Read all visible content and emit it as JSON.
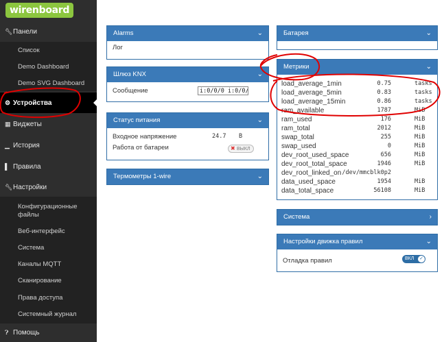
{
  "logo": "wirenboard",
  "sidebar": {
    "panels": "Панели",
    "panel_items": [
      "Список",
      "Demo Dashboard",
      "Demo SVG Dashboard"
    ],
    "devices": "Устройства",
    "widgets": "Виджеты",
    "history": "История",
    "rules": "Правила",
    "settings": "Настройки",
    "settings_items": [
      "Конфигурационные файлы",
      "Веб-интерфейс",
      "Система",
      "Каналы MQTT",
      "Сканирование",
      "Права доступа",
      "Системный журнал"
    ],
    "help": "Помощь"
  },
  "panels": {
    "alarms": {
      "title": "Alarms",
      "log": "Лог"
    },
    "knx": {
      "title": "Шлюз KNX",
      "message_label": "Сообщение",
      "message_value": "i:0/0/0 i:0/0/0"
    },
    "power": {
      "title": "Статус питания",
      "voltage_label": "Входное напряжение",
      "voltage_value": "24.7",
      "voltage_unit": "В",
      "battery_label": "Работа от батареи",
      "battery_toggle": "ВЫКЛ"
    },
    "onewire": {
      "title": "Термометры 1-wire"
    },
    "battery": {
      "title": "Батарея"
    },
    "metrics": {
      "title": "Метрики",
      "rows": [
        {
          "name": "load_average_1min",
          "value": "0.75",
          "unit": "tasks"
        },
        {
          "name": "load_average_5min",
          "value": "0.83",
          "unit": "tasks"
        },
        {
          "name": "load_average_15min",
          "value": "0.86",
          "unit": "tasks"
        },
        {
          "name": "ram_available",
          "value": "1787",
          "unit": "MiB"
        },
        {
          "name": "ram_used",
          "value": "176",
          "unit": "MiB"
        },
        {
          "name": "ram_total",
          "value": "2012",
          "unit": "MiB"
        },
        {
          "name": "swap_total",
          "value": "255",
          "unit": "MiB"
        },
        {
          "name": "swap_used",
          "value": "0",
          "unit": "MiB"
        },
        {
          "name": "dev_root_used_space",
          "value": "656",
          "unit": "MiB"
        },
        {
          "name": "dev_root_total_space",
          "value": "1946",
          "unit": "MiB"
        },
        {
          "name": "dev_root_linked_on",
          "value": "/dev/mmcblk0p2",
          "unit": ""
        },
        {
          "name": "data_used_space",
          "value": "1954",
          "unit": "MiB"
        },
        {
          "name": "data_total_space",
          "value": "56108",
          "unit": "MiB"
        }
      ]
    },
    "system": {
      "title": "Система"
    },
    "rules_engine": {
      "title": "Настройки движка правил",
      "debug_label": "Отладка правил",
      "debug_toggle": "ВКЛ"
    }
  },
  "colors": {
    "sidebar_bg": "#2e2e2e",
    "panel_header": "#3b7ab8",
    "logo_green": "#8cc63f",
    "annotation": "#e00000"
  },
  "icons": {
    "panels": "wrench-icon",
    "devices": "gear-icon",
    "widgets": "widgets-icon",
    "history": "bar-chart-icon",
    "rules": "rules-icon",
    "settings": "wrench-icon",
    "help": "question-circle-icon"
  }
}
